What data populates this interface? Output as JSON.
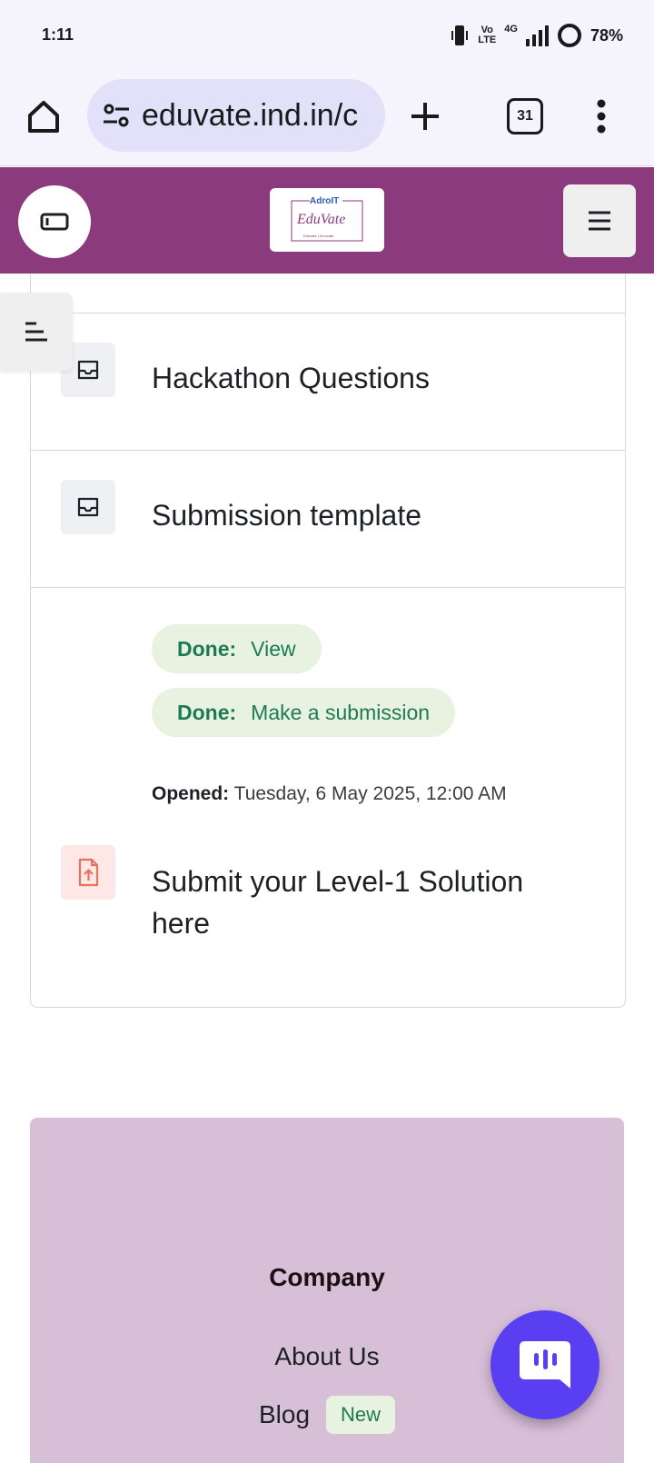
{
  "status_bar": {
    "time": "1:11",
    "network": "4G",
    "volte": "Vo LTE",
    "battery": "78%"
  },
  "browser": {
    "url": "eduvate.ind.in/c",
    "tab_count": "31",
    "icons": [
      "home-icon",
      "site-info-icon",
      "new-tab-icon",
      "tab-switcher-icon",
      "more-menu-icon"
    ]
  },
  "site_header": {
    "logo_top": "AdroIT",
    "logo_main": "EduVate",
    "logo_tagline": "Educate | Innovate",
    "brand_color": "#8b3a7d"
  },
  "activities": [
    {
      "title": "Hackathon Questions",
      "icon": "inbox-icon"
    },
    {
      "title": "Submission template",
      "icon": "inbox-icon"
    }
  ],
  "assignment": {
    "completion": [
      {
        "label": "Done:",
        "value": "View"
      },
      {
        "label": "Done:",
        "value": "Make a submission"
      }
    ],
    "opened_label": "Opened:",
    "opened_value": "Tuesday, 6 May 2025, 12:00 AM",
    "title": "Submit your Level-1 Solution here",
    "icon": "file-upload-icon"
  },
  "footer": {
    "heading": "Company",
    "about": "About Us",
    "blog": "Blog",
    "blog_badge": "New"
  }
}
